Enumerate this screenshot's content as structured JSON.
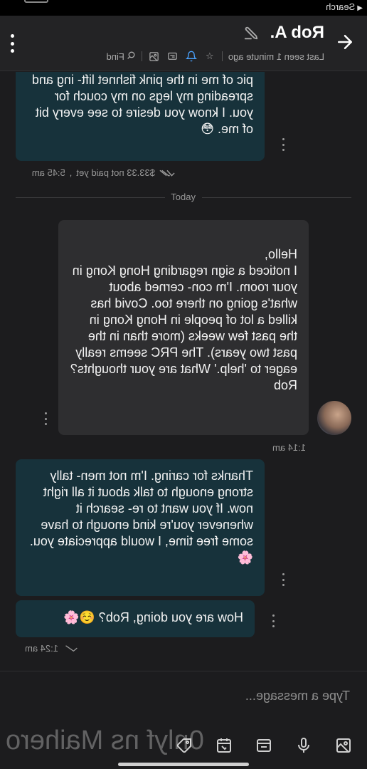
{
  "status_bar": {
    "back_label": "Search"
  },
  "header": {
    "title": "Rob A.",
    "last_seen": "Last seen 1 minute ago",
    "find_label": "Find"
  },
  "messages": [
    {
      "direction": "out",
      "text": "pic of me in the pink fishnet lift- ing and spreading my legs on my couch for you. I know you desire to see every bit of me.",
      "emoji": "😳"
    },
    {
      "direction": "out_meta",
      "price": "$33.33 not paid yet",
      "time": "5:45 am"
    },
    {
      "direction": "in",
      "text": "Hello,\nI noticed a sign regarding Hong Kong in your room. I'm con- cerned about what's going on there too. Covid has killed a lot of people in Hong Kong in the past few weeks (more than in the past two years). The PRC seems really eager to 'help.' What are your thoughts? Rob",
      "time": "1:14 am"
    },
    {
      "direction": "out",
      "text": "Thanks for caring. I'm not men- tally strong enough to talk about it all right now. If you want to re- search it whenever you're kind enough to have some free time, I would appreciate you.",
      "emoji": "🌸"
    },
    {
      "direction": "out",
      "text": "How are you doing, Rob?",
      "emoji": "☺️🌸",
      "time": "1:24 am"
    }
  ],
  "day_divider": "Today",
  "composer": {
    "placeholder": "Type a message...",
    "watermark": "0nlyf ns Maihero"
  },
  "colors": {
    "outgoing_bubble": "#17323b",
    "incoming_bubble": "#2e2e30",
    "accent": "#4aa3ff",
    "background": "#1c1c1e"
  }
}
